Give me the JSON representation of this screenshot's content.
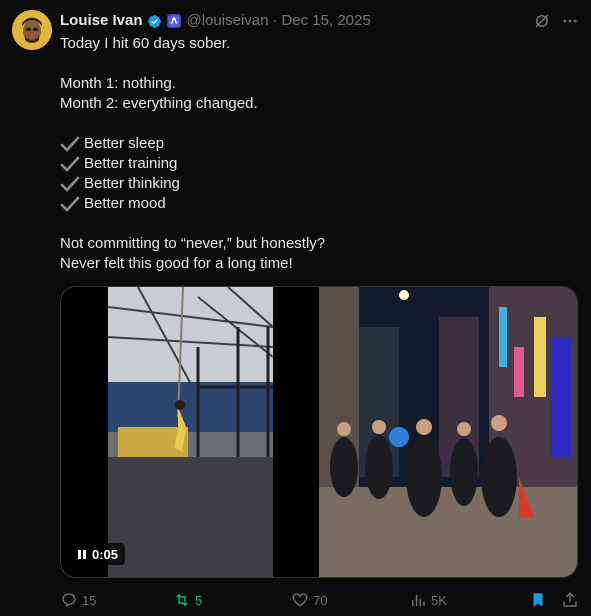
{
  "author": {
    "name": "Louise Ivan",
    "handle": "@louiseivan",
    "separator": "·",
    "date": "Dec 15, 2025"
  },
  "post": {
    "lines": [
      "Today I hit 60 days sober.",
      "",
      "Month 1: nothing.",
      "Month 2: everything changed.",
      ""
    ],
    "checklist": [
      "Better sleep",
      "Better training",
      "Better thinking",
      "Better mood"
    ],
    "closing": [
      "",
      "Not committing to “never,” but honestly?",
      "Never felt this good for a long time!"
    ]
  },
  "media": {
    "video_time": "0:05"
  },
  "actions": {
    "replies": "15",
    "reposts": "5",
    "likes": "70",
    "views": "5K"
  },
  "colors": {
    "background": "#0b0b0b",
    "text": "#e7e9ea",
    "muted": "#71767b",
    "verified": "#1d9bf0",
    "repost_active": "#00ba7c",
    "bookmark_active": "#1d9bf0"
  },
  "icons": [
    "verified-icon",
    "affiliate-badge-icon",
    "grok-icon",
    "more-icon",
    "pause-icon",
    "reply-icon",
    "repost-icon",
    "like-icon",
    "views-icon",
    "bookmark-icon",
    "share-icon"
  ]
}
